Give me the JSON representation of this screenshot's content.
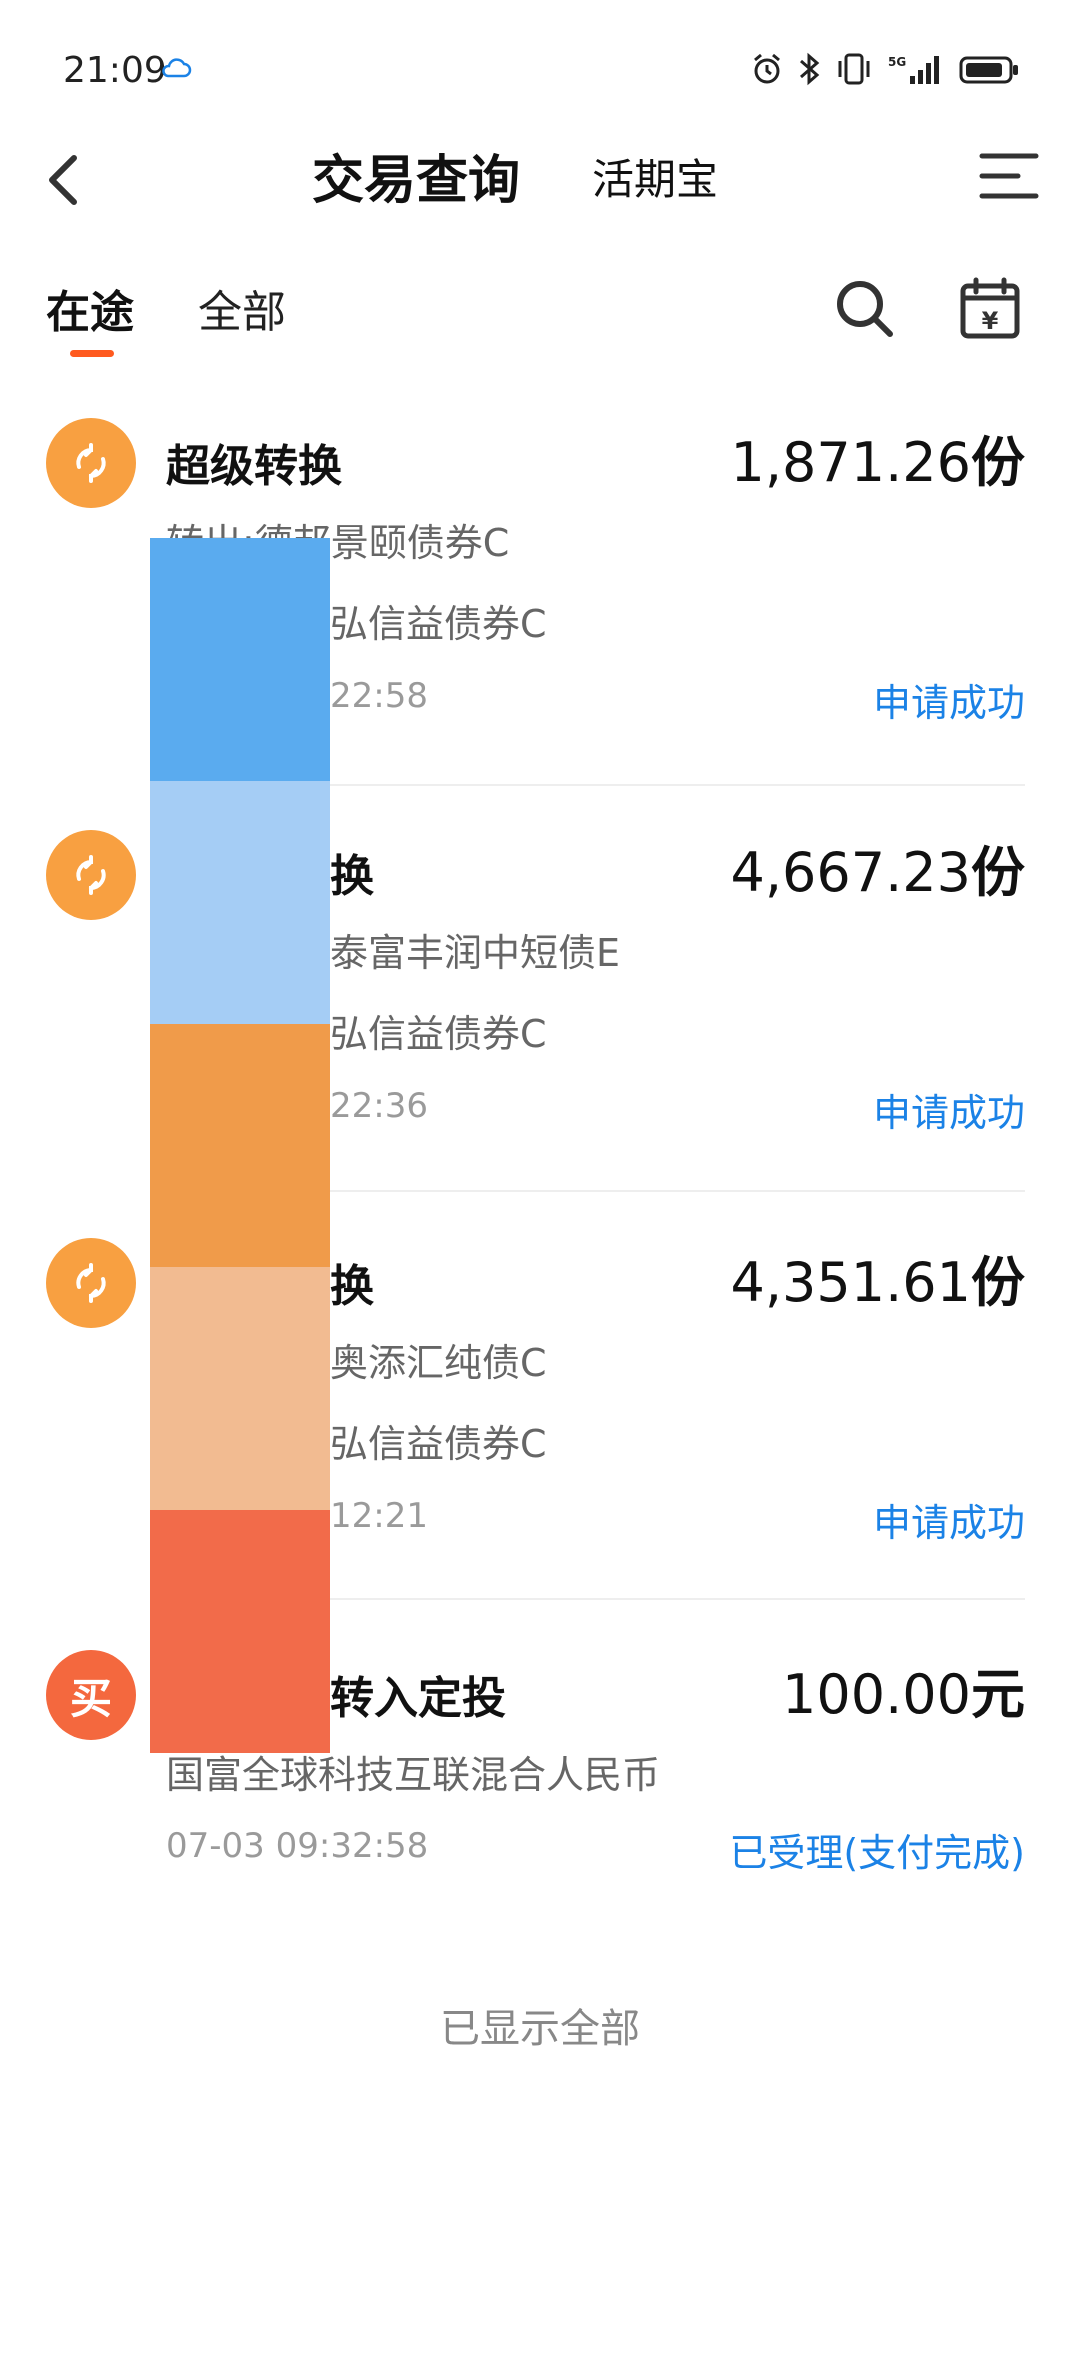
{
  "status_bar": {
    "time": "21:09",
    "icons": [
      "cloud-icon",
      "alarm-icon",
      "bluetooth-icon",
      "vibrate-icon",
      "signal-5g-icon",
      "battery-icon"
    ]
  },
  "header": {
    "title": "交易查询",
    "subtitle": "活期宝"
  },
  "tabs": [
    {
      "label": "在途",
      "active": true
    },
    {
      "label": "全部",
      "active": false
    }
  ],
  "colors": {
    "accent_orange": "#f8a041",
    "buy_red": "#f4683e",
    "tab_underline": "#ff5a1f",
    "status_blue": "#1b82e6"
  },
  "transactions": [
    {
      "type": "超级转换",
      "amount": "1,871.26",
      "unit": "份",
      "line1": "转出:德邦景颐债券C",
      "line2": "弘信益债券C",
      "time": "22:58",
      "status": "申请成功",
      "icon": "exchange-icon"
    },
    {
      "type": "换",
      "amount": "4,667.23",
      "unit": "份",
      "line1": "泰富丰润中短债E",
      "line2": "弘信益债券C",
      "time": "22:36",
      "status": "申请成功",
      "icon": "exchange-icon"
    },
    {
      "type": "换",
      "amount": "4,351.61",
      "unit": "份",
      "line1": "奥添汇纯债C",
      "line2": "弘信益债券C",
      "time": "12:21",
      "status": "申请成功",
      "icon": "exchange-icon"
    },
    {
      "type": "转入定投",
      "amount": "100.00",
      "unit": "元",
      "line1": "国富全球科技互联混合人民币",
      "line2": "",
      "time": "07-03 09:32:58",
      "status": "已受理(支付完成)",
      "icon_text": "买"
    }
  ],
  "footer": "已显示全部",
  "redaction_colors": [
    "#5aabef",
    "#a5cdf5",
    "#f09b4a",
    "#f2bb91",
    "#f26b4a"
  ]
}
